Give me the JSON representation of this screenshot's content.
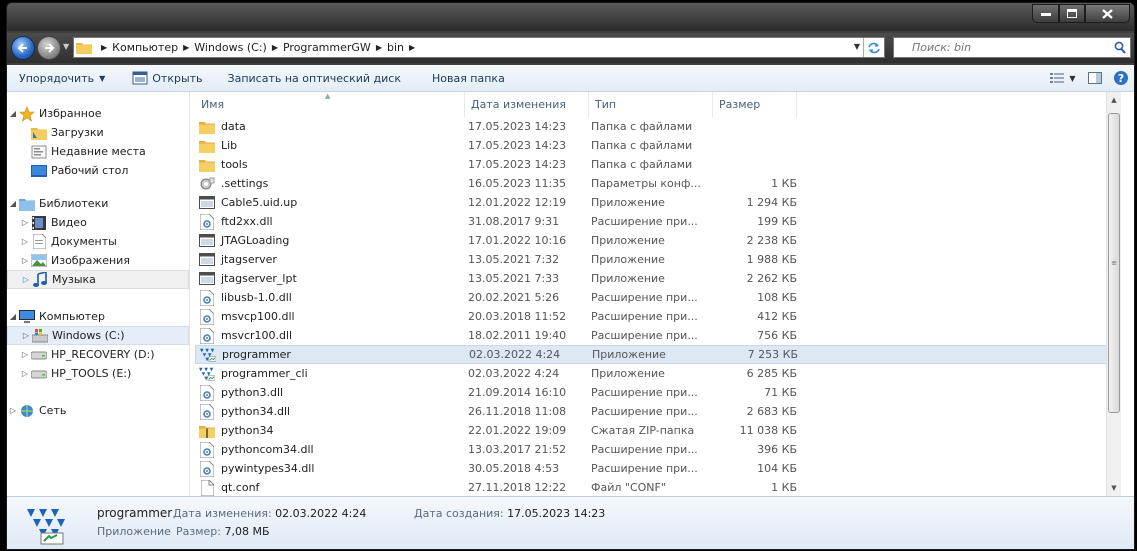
{
  "window": {
    "controls": {
      "minimize": "–",
      "maximize": "□",
      "close": "x"
    }
  },
  "address": {
    "crumbs": [
      "Компьютер",
      "Windows (C:)",
      "ProgrammerGW",
      "bin"
    ],
    "search_placeholder": "Поиск: bin"
  },
  "toolbar": {
    "organize": "Упорядочить",
    "open": "Открыть",
    "burn": "Записать на оптический диск",
    "new_folder": "Новая папка"
  },
  "nav": {
    "favorites": "Избранное",
    "downloads": "Загрузки",
    "recent": "Недавние места",
    "desktop": "Рабочий стол",
    "libraries": "Библиотеки",
    "video": "Видео",
    "documents": "Документы",
    "images": "Изображения",
    "music": "Музыка",
    "computer": "Компьютер",
    "drive_c": "Windows (C:)",
    "drive_d": "HP_RECOVERY (D:)",
    "drive_e": "HP_TOOLS (E:)",
    "network": "Сеть"
  },
  "columns": {
    "name": "Имя",
    "date": "Дата изменения",
    "type": "Тип",
    "size": "Размер"
  },
  "files": [
    {
      "icon": "folder",
      "name": "data",
      "date": "17.05.2023 14:23",
      "type": "Папка с файлами",
      "size": ""
    },
    {
      "icon": "folder",
      "name": "Lib",
      "date": "17.05.2023 14:23",
      "type": "Папка с файлами",
      "size": ""
    },
    {
      "icon": "folder",
      "name": "tools",
      "date": "17.05.2023 14:23",
      "type": "Папка с файлами",
      "size": ""
    },
    {
      "icon": "settings",
      "name": ".settings",
      "date": "16.05.2023 11:35",
      "type": "Параметры конф...",
      "size": "1 КБ"
    },
    {
      "icon": "app",
      "name": "Cable5.uid.up",
      "date": "12.01.2022 12:19",
      "type": "Приложение",
      "size": "1 294 КБ"
    },
    {
      "icon": "dll",
      "name": "ftd2xx.dll",
      "date": "31.08.2017 9:31",
      "type": "Расширение при...",
      "size": "199 КБ"
    },
    {
      "icon": "app",
      "name": "JTAGLoading",
      "date": "17.01.2022 10:16",
      "type": "Приложение",
      "size": "2 238 КБ"
    },
    {
      "icon": "app",
      "name": "jtagserver",
      "date": "13.05.2021 7:32",
      "type": "Приложение",
      "size": "1 988 КБ"
    },
    {
      "icon": "app",
      "name": "jtagserver_lpt",
      "date": "13.05.2021 7:33",
      "type": "Приложение",
      "size": "2 262 КБ"
    },
    {
      "icon": "dll",
      "name": "libusb-1.0.dll",
      "date": "20.02.2021 5:26",
      "type": "Расширение при...",
      "size": "108 КБ"
    },
    {
      "icon": "dll",
      "name": "msvcp100.dll",
      "date": "20.03.2018 11:52",
      "type": "Расширение при...",
      "size": "412 КБ"
    },
    {
      "icon": "dll",
      "name": "msvcr100.dll",
      "date": "18.02.2011 19:40",
      "type": "Расширение при...",
      "size": "756 КБ"
    },
    {
      "icon": "programmer",
      "name": "programmer",
      "date": "02.03.2022 4:24",
      "type": "Приложение",
      "size": "7 253 КБ",
      "selected": true
    },
    {
      "icon": "programmer",
      "name": "programmer_cli",
      "date": "02.03.2022 4:24",
      "type": "Приложение",
      "size": "6 285 КБ"
    },
    {
      "icon": "dll",
      "name": "python3.dll",
      "date": "21.09.2014 16:10",
      "type": "Расширение при...",
      "size": "71 КБ"
    },
    {
      "icon": "dll",
      "name": "python34.dll",
      "date": "26.11.2018 11:08",
      "type": "Расширение при...",
      "size": "2 683 КБ"
    },
    {
      "icon": "zip",
      "name": "python34",
      "date": "22.01.2022 19:09",
      "type": "Сжатая ZIP-папка",
      "size": "11 038 КБ"
    },
    {
      "icon": "dll",
      "name": "pythoncom34.dll",
      "date": "13.03.2017 21:52",
      "type": "Расширение при...",
      "size": "396 КБ"
    },
    {
      "icon": "dll",
      "name": "pywintypes34.dll",
      "date": "30.05.2018 4:53",
      "type": "Расширение при...",
      "size": "104 КБ"
    },
    {
      "icon": "file",
      "name": "qt.conf",
      "date": "27.11.2018 12:22",
      "type": "Файл \"CONF\"",
      "size": "1 КБ"
    }
  ],
  "details": {
    "name": "programmer",
    "type": "Приложение",
    "modified_label": "Дата изменения:",
    "modified_value": "02.03.2022 4:24",
    "size_label": "Размер:",
    "size_value": "7,08 МБ",
    "created_label": "Дата создания:",
    "created_value": "17.05.2023 14:23"
  }
}
